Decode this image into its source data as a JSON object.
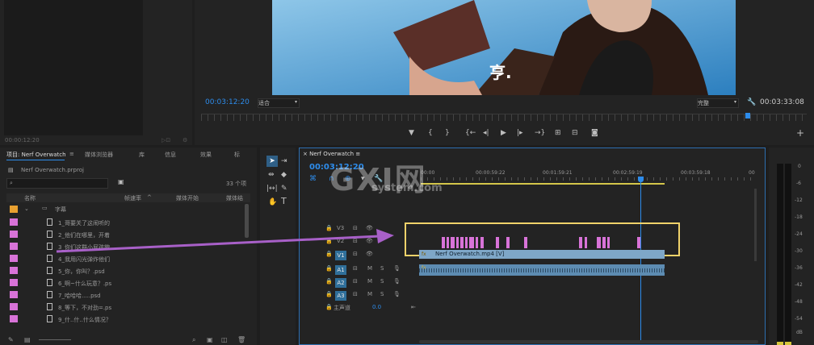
{
  "source_monitor": {
    "timecode": "00:00:12:20"
  },
  "program_monitor": {
    "subtitle": "亨.",
    "timecode": "00:03:12:20",
    "fit_label": "适合",
    "quality_label": "完整",
    "duration": "00:03:33:08"
  },
  "project_panel": {
    "tabs": [
      "项目: Nerf Overwatch",
      "媒体浏览器",
      "库",
      "信息",
      "效果",
      "标"
    ],
    "file": "Nerf Overwatch.prproj",
    "count": "33 个项",
    "columns": [
      "名称",
      "帧速率",
      "媒体开始",
      "媒体结"
    ],
    "folder": "字幕",
    "items": [
      "1_哥要关了这闹听的",
      "2_他们在哪里，开着",
      "3_你们这群小屁孩貌",
      "4_我用闪光弹炸他们",
      "5_你，你叫？.psd",
      "6_啊~什么玩意？.ps",
      "7_哈哈哈.....psd",
      "8_等下，不对劲=.ps",
      "9_什..什..什么情况？"
    ]
  },
  "timeline": {
    "tab": "Nerf Overwatch",
    "timecode": "00:03:12:20",
    "ruler": [
      "00:00",
      "00:00:59:22",
      "00:01:59:21",
      "00:02:59:19",
      "00:03:59:18",
      "00"
    ],
    "tracks_video": [
      "V3",
      "V2",
      "V1"
    ],
    "tracks_audio": [
      "A1",
      "A2",
      "A3"
    ],
    "master_label": "主声道",
    "master_value": "0.0",
    "clip_label": "Nerf Overwatch.mp4 [V]",
    "fx_label": "fx"
  },
  "watermark": {
    "big": "GXI网",
    "small": "system.com"
  },
  "meter": {
    "ticks": [
      "0",
      "-6",
      "-12",
      "-18",
      "-24",
      "-30",
      "-36",
      "-42",
      "-48",
      "-54",
      "dB"
    ]
  },
  "colors": {
    "accent": "#2d8ceb",
    "highlight": "#f0d26a",
    "arrow": "#a860c8",
    "chip": "#d873d8"
  }
}
